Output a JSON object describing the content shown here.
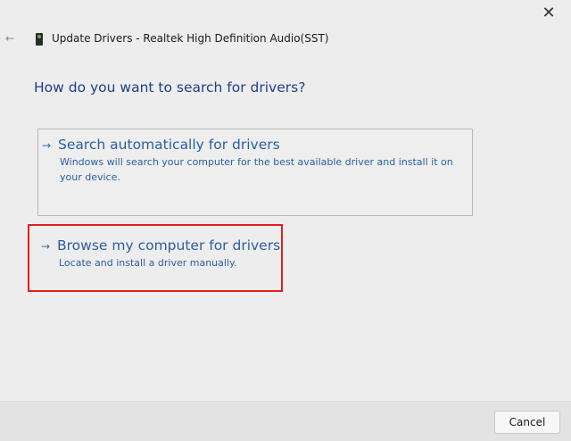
{
  "window": {
    "title": "Update Drivers - Realtek High Definition Audio(SST)",
    "close_glyph": "✕",
    "back_glyph": "←"
  },
  "heading": "How do you want to search for drivers?",
  "options": [
    {
      "arrow": "→",
      "title": "Search automatically for drivers",
      "description": "Windows will search your computer for the best available driver and install it on your device."
    },
    {
      "arrow": "→",
      "title": "Browse my computer for drivers",
      "description": "Locate and install a driver manually."
    }
  ],
  "footer": {
    "cancel_label": "Cancel"
  },
  "colors": {
    "accent": "#2b5fa0",
    "heading": "#1e3f8a",
    "highlight": "#e0201c"
  },
  "icons": {
    "device": "audio-device-icon",
    "close": "close-icon",
    "back": "back-arrow-icon"
  }
}
